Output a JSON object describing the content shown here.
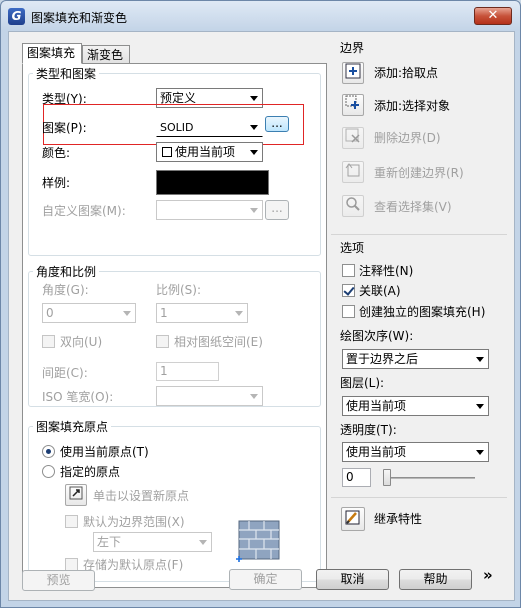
{
  "window": {
    "title": "图案填充和渐变色",
    "icon_name": "gstarcad-app-icon",
    "close_label": "✕"
  },
  "tabs": [
    {
      "label": "图案填充",
      "active": true
    },
    {
      "label": "渐变色",
      "active": false
    }
  ],
  "type_pattern": {
    "group_title": "类型和图案",
    "type_label": "类型(Y):",
    "type_value": "预定义",
    "pattern_label": "图案(P):",
    "pattern_value": "SOLID",
    "pattern_browse": "...",
    "color_label": "颜色:",
    "color_value": "使用当前项",
    "swatch_label": "样例:",
    "swatch_color": "#000000",
    "custom_label": "自定义图案(M):",
    "custom_value": "",
    "custom_browse": "..."
  },
  "angle_scale": {
    "group_title": "角度和比例",
    "angle_label": "角度(G):",
    "angle_value": "0",
    "scale_label": "比例(S):",
    "scale_value": "1",
    "double_label": "双向(U)",
    "relative_label": "相对图纸空间(E)",
    "spacing_label": "间距(C):",
    "spacing_value": "1",
    "iso_label": "ISO 笔宽(O):",
    "iso_value": ""
  },
  "origin": {
    "group_title": "图案填充原点",
    "use_current_label": "使用当前原点(T)",
    "specified_label": "指定的原点",
    "click_set_label": "单击以设置新原点",
    "default_extent_label": "默认为边界范围(X)",
    "extent_value": "左下",
    "store_default_label": "存储为默认原点(F)"
  },
  "boundary": {
    "group_title": "边界",
    "add_pick_label": "添加:拾取点",
    "add_select_label": "添加:选择对象",
    "remove_label": "删除边界(D)",
    "recreate_label": "重新创建边界(R)",
    "view_label": "查看选择集(V)"
  },
  "options": {
    "group_title": "选项",
    "annotative_label": "注释性(N)",
    "associative_label": "关联(A)",
    "associative_checked": true,
    "separate_label": "创建独立的图案填充(H)",
    "draw_order_label": "绘图次序(W):",
    "draw_order_value": "置于边界之后",
    "layer_label": "图层(L):",
    "layer_value": "使用当前项",
    "transparency_label": "透明度(T):",
    "transparency_value": "使用当前项",
    "transparency_number": "0",
    "transparency_level": 0
  },
  "inherit_label": "继承特性",
  "footer": {
    "preview": "预览",
    "ok": "确定",
    "cancel": "取消",
    "help": "帮助",
    "more": "»"
  },
  "colors": {
    "highlight_box": "#e02525",
    "accent": "#1c3e74"
  }
}
